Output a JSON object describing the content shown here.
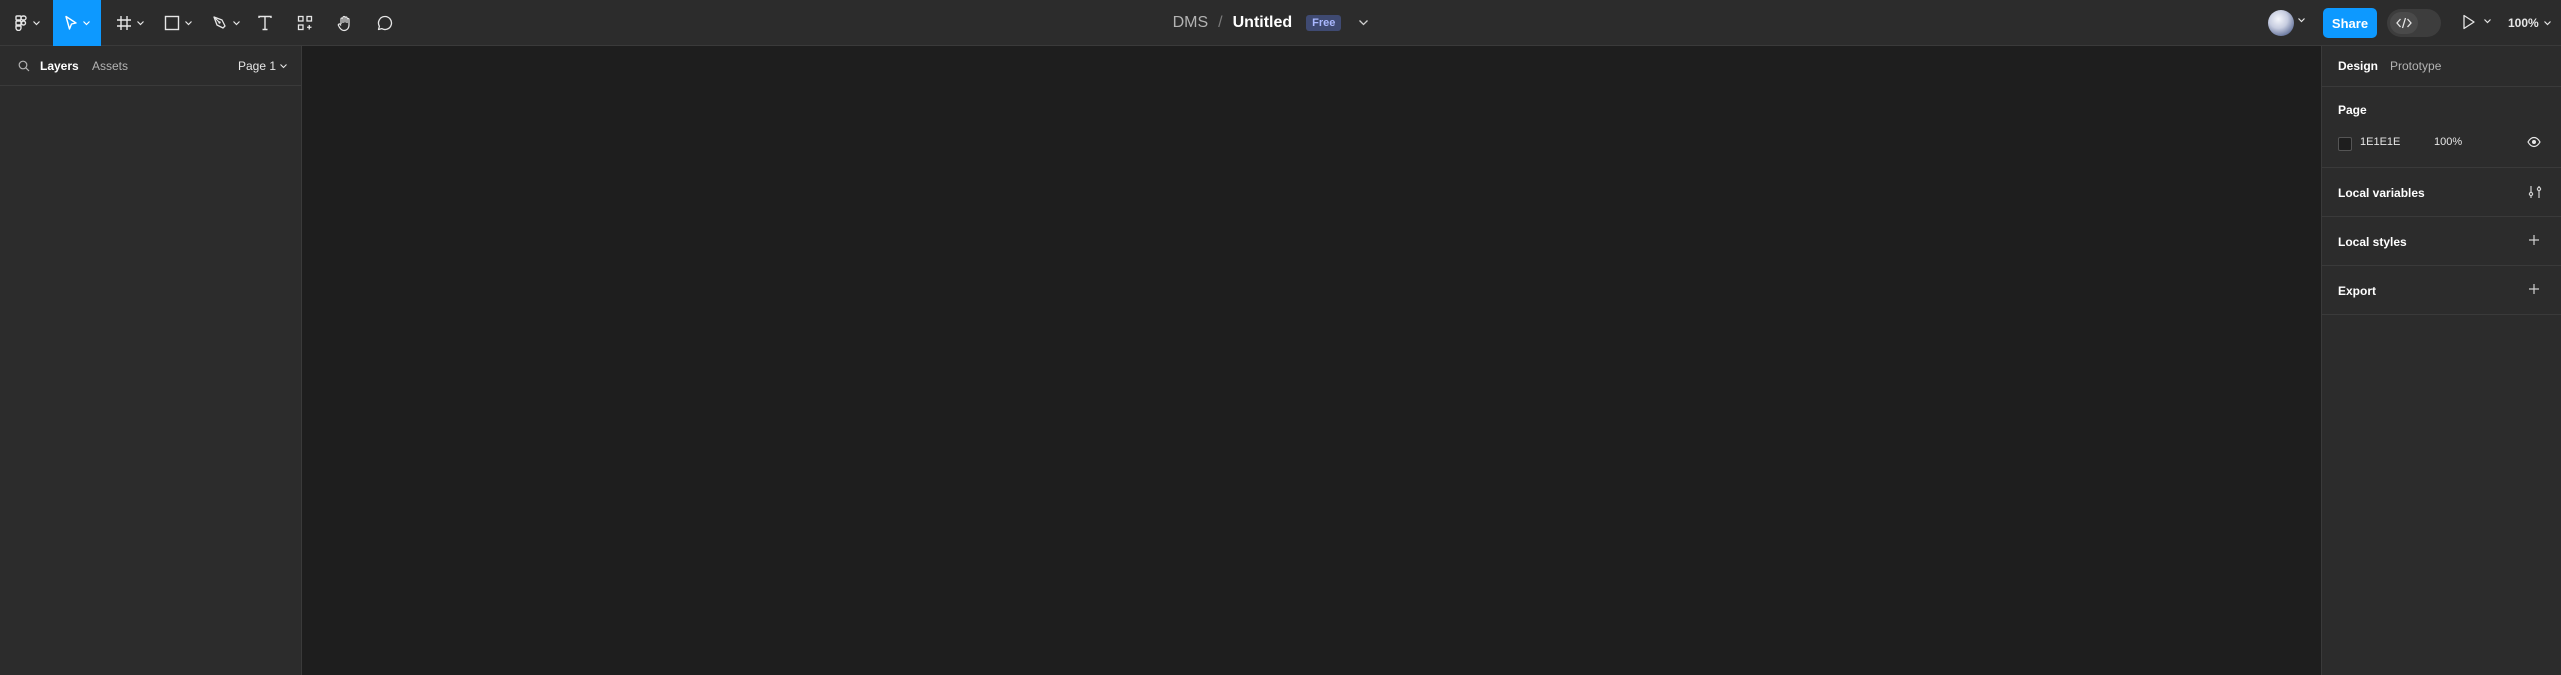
{
  "topbar": {
    "project": "DMS",
    "separator": "/",
    "file_name": "Untitled",
    "plan_badge": "Free",
    "share_label": "Share",
    "zoom_level": "100%",
    "icons": [
      "figma-menu-icon",
      "move-tool-icon",
      "frame-tool-icon",
      "shape-tool-icon",
      "pen-tool-icon",
      "text-tool-icon",
      "resources-icon",
      "hand-tool-icon",
      "comment-icon",
      "dev-mode-icon",
      "present-icon"
    ]
  },
  "left_panel": {
    "tabs": [
      "Layers",
      "Assets"
    ],
    "page_selector": "Page 1"
  },
  "right_panel": {
    "tabs": [
      "Design",
      "Prototype"
    ],
    "page_section": {
      "title": "Page",
      "color_hex": "1E1E1E",
      "opacity": "100%"
    },
    "sections": [
      {
        "title": "Local variables"
      },
      {
        "title": "Local styles"
      },
      {
        "title": "Export"
      }
    ]
  },
  "colors": {
    "accent": "#0d99ff",
    "canvas": "#1e1e1e",
    "panel": "#2c2c2c"
  }
}
